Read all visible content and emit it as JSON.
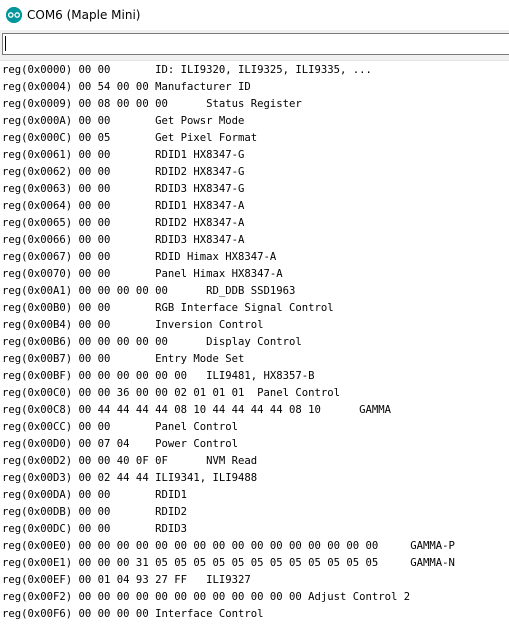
{
  "window": {
    "title": "COM6 (Maple Mini)",
    "icon": "arduino-logo-icon",
    "accent": "#00979c"
  },
  "input": {
    "value": ""
  },
  "output": {
    "lines": [
      "reg(0x0000) 00 00       ID: ILI9320, ILI9325, ILI9335, ...",
      "reg(0x0004) 00 54 00 00 Manufacturer ID",
      "reg(0x0009) 00 08 00 00 00      Status Register",
      "reg(0x000A) 00 00       Get Powsr Mode",
      "reg(0x000C) 00 05       Get Pixel Format",
      "reg(0x0061) 00 00       RDID1 HX8347-G",
      "reg(0x0062) 00 00       RDID2 HX8347-G",
      "reg(0x0063) 00 00       RDID3 HX8347-G",
      "reg(0x0064) 00 00       RDID1 HX8347-A",
      "reg(0x0065) 00 00       RDID2 HX8347-A",
      "reg(0x0066) 00 00       RDID3 HX8347-A",
      "reg(0x0067) 00 00       RDID Himax HX8347-A",
      "reg(0x0070) 00 00       Panel Himax HX8347-A",
      "reg(0x00A1) 00 00 00 00 00      RD_DDB SSD1963",
      "reg(0x00B0) 00 00       RGB Interface Signal Control",
      "reg(0x00B4) 00 00       Inversion Control",
      "reg(0x00B6) 00 00 00 00 00      Display Control",
      "reg(0x00B7) 00 00       Entry Mode Set",
      "reg(0x00BF) 00 00 00 00 00 00   ILI9481, HX8357-B",
      "reg(0x00C0) 00 00 36 00 00 02 01 01 01  Panel Control",
      "reg(0x00C8) 00 44 44 44 44 08 10 44 44 44 44 08 10      GAMMA",
      "reg(0x00CC) 00 00       Panel Control",
      "reg(0x00D0) 00 07 04    Power Control",
      "reg(0x00D2) 00 00 40 0F 0F      NVM Read",
      "reg(0x00D3) 00 02 44 44 ILI9341, ILI9488",
      "reg(0x00DA) 00 00       RDID1",
      "reg(0x00DB) 00 00       RDID2",
      "reg(0x00DC) 00 00       RDID3",
      "reg(0x00E0) 00 00 00 00 00 00 00 00 00 00 00 00 00 00 00 00     GAMMA-P",
      "reg(0x00E1) 00 00 00 31 05 05 05 05 05 05 05 05 05 05 05 05     GAMMA-N",
      "reg(0x00EF) 00 01 04 93 27 FF   ILI9327",
      "reg(0x00F2) 00 00 00 00 00 00 00 00 00 00 00 00 Adjust Control 2",
      "reg(0x00F6) 00 00 00 00 Interface Control"
    ]
  }
}
